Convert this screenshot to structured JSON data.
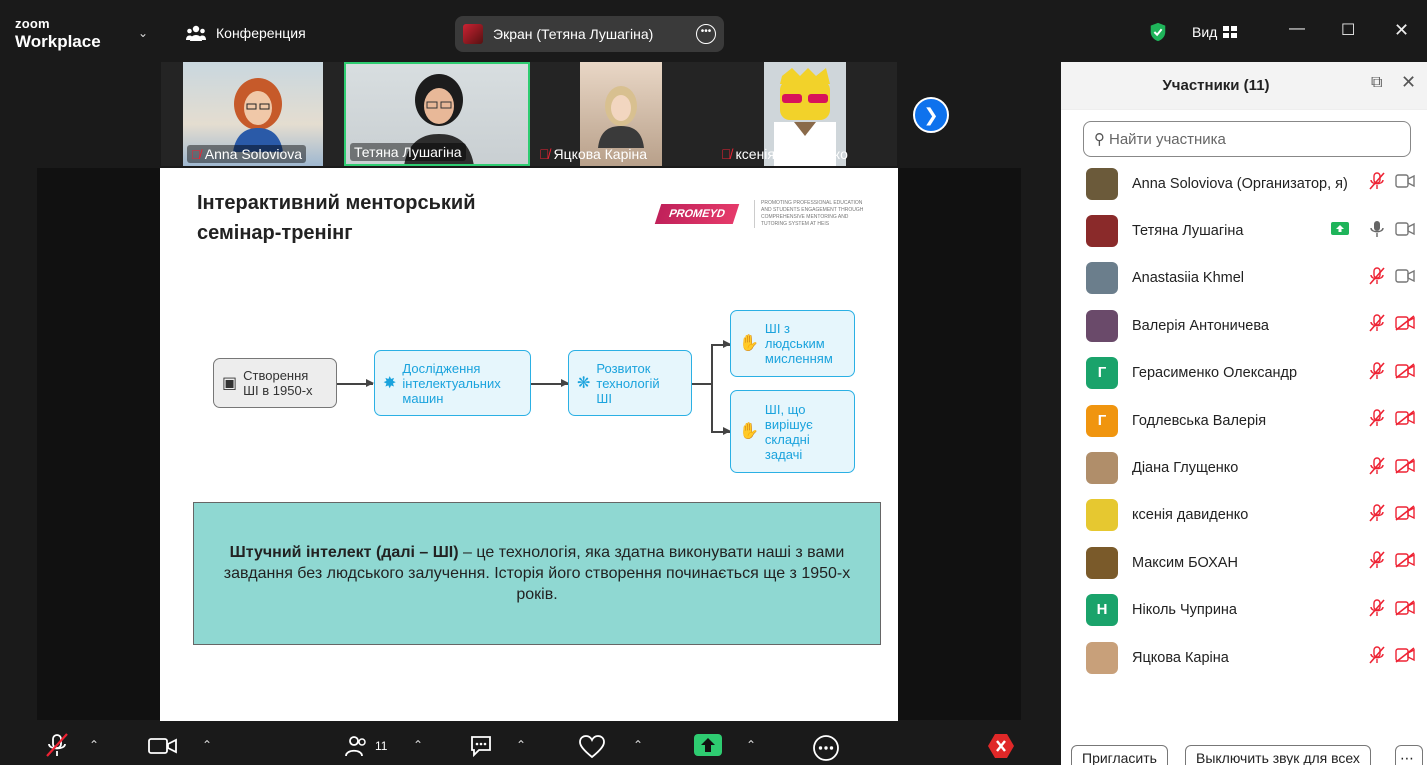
{
  "titlebar": {
    "logo_top": "zoom",
    "logo_bottom": "Workplace",
    "meeting_label": "Конференция",
    "share_label": "Экран (Тетяна Лушагіна)",
    "view_label": "Вид"
  },
  "strip": {
    "tiles": [
      {
        "name": "Anna Soloviova",
        "muted": true
      },
      {
        "name": "Тетяна Лушагіна",
        "muted": false
      },
      {
        "name": "Яцкова Каріна",
        "muted": true
      },
      {
        "name": "ксенія давиденко",
        "muted": true
      }
    ]
  },
  "slide": {
    "title_line1": "Інтерактивний менторський",
    "title_line2": "семінар-тренінг",
    "brand": "PROMEYD",
    "brand_tagline": "PROMOTING PROFESSIONAL EDUCATION AND STUDENTS ENGAGEMENT THROUGH COMPREHENSIVE MENTORING AND TUTORING SYSTEM AT HEIS",
    "node1": "Створення ШІ в 1950-х",
    "node2": "Дослідження інтелектуальних машин",
    "node3": "Розвиток технологій ШІ",
    "node4": "ШІ з людським мисленням",
    "node5": "ШІ, що вирішує складні задачі",
    "definition_bold": "Штучний інтелект (далі – ШІ)",
    "definition_rest": " – це технологія, яка здатна виконувати наші з вами завдання без людського залучення. Історія його створення починається ще з 1950-х років."
  },
  "toolbar": {
    "participants_count": "11"
  },
  "panel": {
    "title": "Участники (11)",
    "search_placeholder": "Найти участника",
    "participants": [
      {
        "name": "Anna Soloviova (Организатор, я)",
        "initial": "",
        "color": "#6b5a3a",
        "mic": "muted",
        "video": "on"
      },
      {
        "name": "Тетяна Лушагіна",
        "initial": "",
        "color": "#8a2a2a",
        "mic": "on",
        "video": "on",
        "sharing": true
      },
      {
        "name": "Anastasiia Khmel",
        "initial": "",
        "color": "#6b7e8c",
        "mic": "muted",
        "video": "on"
      },
      {
        "name": "Валерія Антоничева",
        "initial": "",
        "color": "#6a4a6a",
        "mic": "muted",
        "video": "off"
      },
      {
        "name": "Герасименко Олександр",
        "initial": "Г",
        "color": "#1aa36b",
        "mic": "muted",
        "video": "off"
      },
      {
        "name": "Годлевська Валерія",
        "initial": "Г",
        "color": "#f0950f",
        "mic": "muted",
        "video": "off"
      },
      {
        "name": "Діана Глущенко",
        "initial": "",
        "color": "#b08e6a",
        "mic": "muted",
        "video": "off"
      },
      {
        "name": "ксенія давиденко",
        "initial": "",
        "color": "#e6c830",
        "mic": "muted",
        "video": "off"
      },
      {
        "name": "Максим БОХАН",
        "initial": "",
        "color": "#7a5a2a",
        "mic": "muted",
        "video": "off"
      },
      {
        "name": "Ніколь Чуприна",
        "initial": "Н",
        "color": "#1aa36b",
        "mic": "muted",
        "video": "off"
      },
      {
        "name": "Яцкова Каріна",
        "initial": "",
        "color": "#c8a07a",
        "mic": "muted",
        "video": "off"
      }
    ],
    "invite_label": "Пригласить",
    "mute_all_label": "Выключить звук для всех"
  }
}
